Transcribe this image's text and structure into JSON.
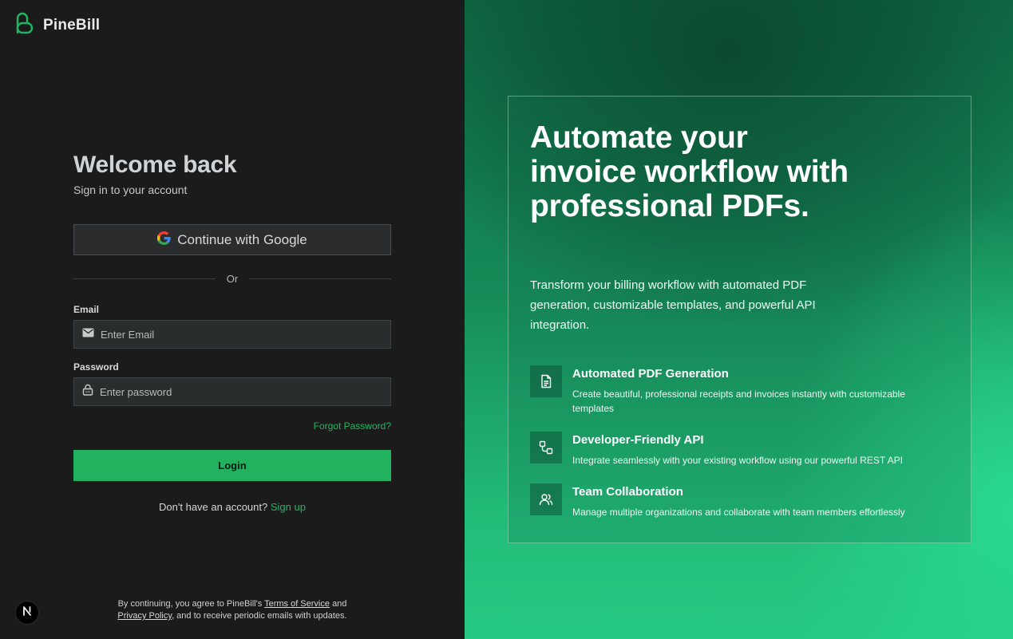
{
  "brand": {
    "name": "PineBill",
    "color": "#21b562"
  },
  "login": {
    "title": "Welcome back",
    "subtitle": "Sign in to your account",
    "google_label": "Continue with Google",
    "divider": "Or",
    "email_label": "Email",
    "email_placeholder": "Enter Email",
    "password_label": "Password",
    "password_placeholder": "Enter password",
    "forgot": "Forgot Password?",
    "login_label": "Login",
    "signup_prompt": "Don't have an account?",
    "signup_link": "Sign up"
  },
  "legal": {
    "prefix": "By continuing, you agree to PineBill's",
    "terms": "Terms of Service",
    "and": "and",
    "privacy": "Privacy Policy",
    "suffix": ", and to receive periodic emails with updates."
  },
  "badge": {
    "letter": "N"
  },
  "hero": {
    "headline": "Automate your invoice workflow with professional PDFs.",
    "lead": "Transform your billing workflow with automated PDF generation, customizable templates, and powerful API integration.",
    "features": [
      {
        "icon": "document-icon",
        "title": "Automated PDF Generation",
        "desc": "Create beautiful, professional receipts and invoices instantly with customizable templates"
      },
      {
        "icon": "workflow-icon",
        "title": "Developer-Friendly API",
        "desc": "Integrate seamlessly with your existing workflow using our powerful REST API"
      },
      {
        "icon": "users-icon",
        "title": "Team Collaboration",
        "desc": "Manage multiple organizations and collaborate with team members effortlessly"
      }
    ]
  },
  "colors": {
    "accent": "#22b25f",
    "left_bg": "#1b1b1c"
  }
}
